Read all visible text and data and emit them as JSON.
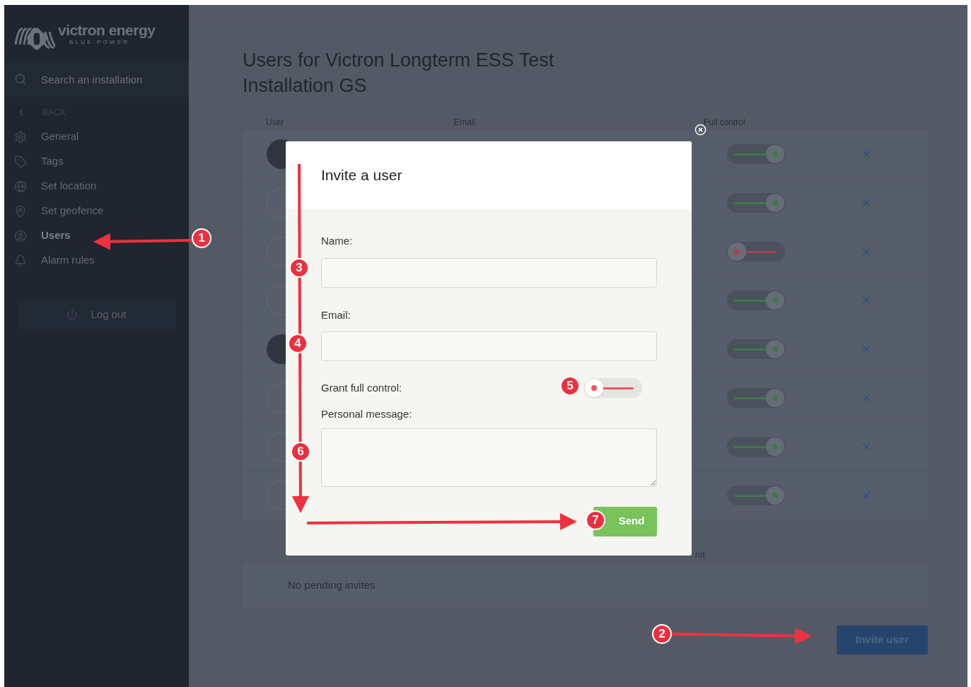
{
  "logo": {
    "name": "victron energy",
    "tagline": "BLUE POWER"
  },
  "sidebar": {
    "search": {
      "placeholder": "Search an installation"
    },
    "back": "BACK",
    "items": [
      {
        "label": "General",
        "selected": false
      },
      {
        "label": "Tags",
        "selected": false
      },
      {
        "label": "Set location",
        "selected": false
      },
      {
        "label": "Set geofence",
        "selected": false
      },
      {
        "label": "Users",
        "selected": true
      },
      {
        "label": "Alarm rules",
        "selected": false
      }
    ],
    "logout": "Log out"
  },
  "page_title": "Users for Victron Longterm ESS Test Installation GS",
  "table": {
    "columns": [
      "User",
      "Email",
      "Full control"
    ],
    "rows": [
      {
        "avatar": {
          "kind": "photo"
        },
        "full_control": true
      },
      {
        "avatar": {
          "kind": "initials"
        },
        "full_control": true
      },
      {
        "avatar": {
          "kind": "initials"
        },
        "full_control": false
      },
      {
        "avatar": {
          "kind": "initials"
        },
        "full_control": true
      },
      {
        "avatar": {
          "kind": "photo"
        },
        "full_control": true
      },
      {
        "avatar": {
          "kind": "initials"
        },
        "full_control": true
      },
      {
        "avatar": {
          "kind": "initials"
        },
        "full_control": true
      },
      {
        "avatar": {
          "kind": "initials"
        },
        "full_control": true
      }
    ]
  },
  "pending": {
    "column_3": "rol",
    "empty_text": "No pending invites"
  },
  "invite_button": "Invite user",
  "modal": {
    "title": "Invite a user",
    "name_label": "Name:",
    "email_label": "Email:",
    "grant_label": "Grant full control:",
    "grant_on": false,
    "message_label": "Personal message:",
    "send": "Send"
  },
  "annotations": [
    {
      "label": "1"
    },
    {
      "label": "2"
    },
    {
      "label": "3"
    },
    {
      "label": "4"
    },
    {
      "label": "5"
    },
    {
      "label": "6"
    },
    {
      "label": "7"
    }
  ]
}
